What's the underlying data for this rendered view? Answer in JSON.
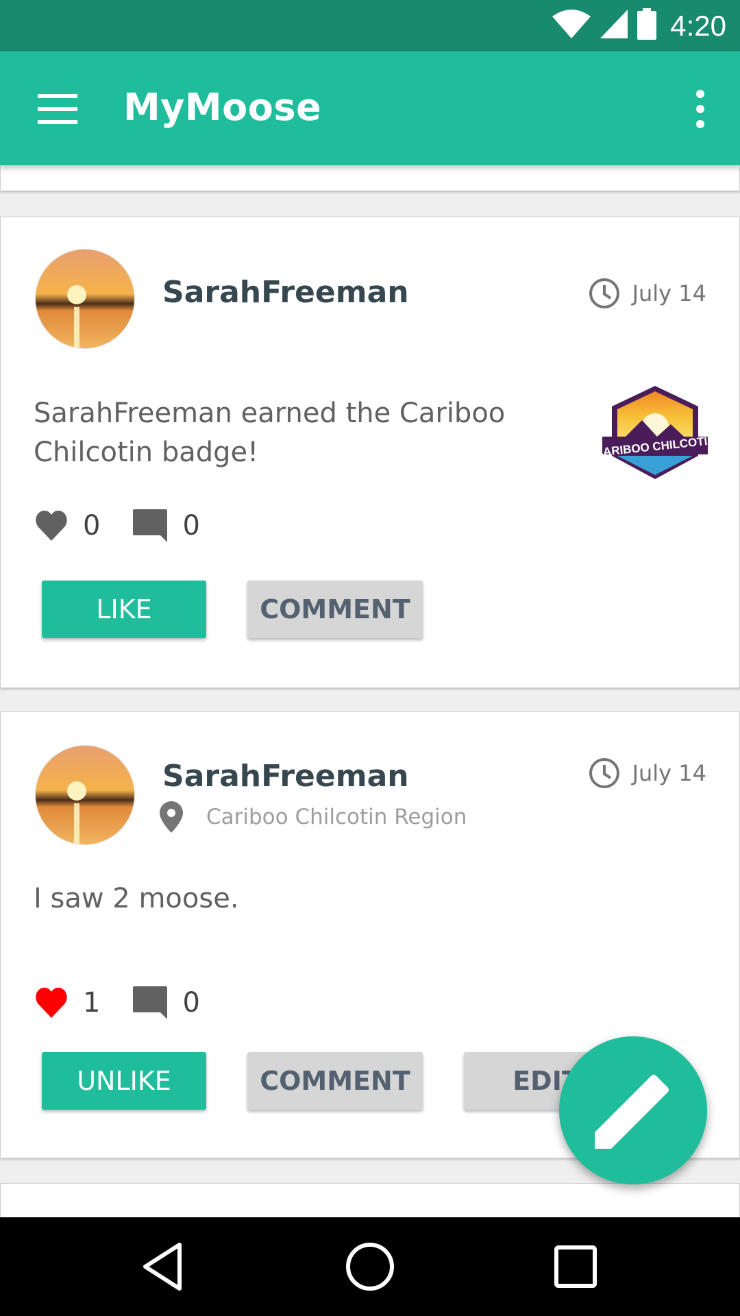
{
  "status_bar": {
    "time": "4:20",
    "icons": [
      "wifi-icon",
      "cell-signal-icon",
      "battery-icon"
    ]
  },
  "app_bar": {
    "title": "MyMoose",
    "menu_icon": "hamburger-menu-icon",
    "overflow_icon": "more-vert-icon"
  },
  "posts": [
    {
      "username": "SarahFreeman",
      "date": "July 14",
      "text": "SarahFreeman earned the Cariboo Chilcotin badge!",
      "badge_label": "CARIBOO CHILCOTIN",
      "likes": "0",
      "comments": "0",
      "liked": false,
      "buttons": {
        "like": "LIKE",
        "comment": "COMMENT"
      }
    },
    {
      "username": "SarahFreeman",
      "date": "July 14",
      "location": "Cariboo Chilcotin Region",
      "text": "I saw 2 moose.",
      "likes": "1",
      "comments": "0",
      "liked": true,
      "buttons": {
        "like": "UNLIKE",
        "comment": "COMMENT",
        "edit": "EDIT"
      }
    }
  ],
  "colors": {
    "primary": "#1fbd9b",
    "status_bar": "#188a6e",
    "liked_heart": "#ff0000",
    "secondary_button": "#d6d6d6"
  },
  "fab_icon": "pencil-icon",
  "nav_bar": {
    "icons": [
      "back-icon",
      "home-icon",
      "recents-icon"
    ]
  }
}
